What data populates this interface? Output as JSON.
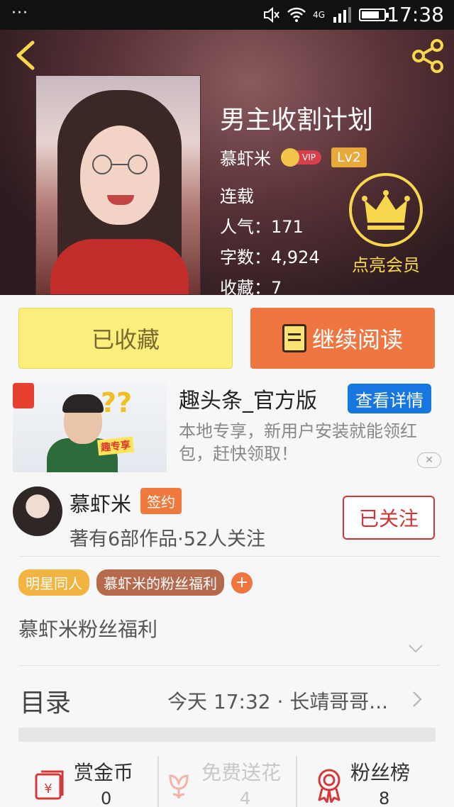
{
  "status_bar": {
    "time": "17:38",
    "network": "4G",
    "battery_level": 0.8,
    "icons": [
      "more-dots-icon",
      "mute-icon",
      "wifi-icon",
      "signal-icon",
      "battery-icon"
    ]
  },
  "header": {
    "title": "男主收割计划",
    "author": "慕虾米",
    "vip_badge": "VIP",
    "level": "Lv2",
    "status": "连载",
    "popularity_label": "人气：",
    "popularity": "171",
    "words_label": "字数：",
    "words": "4,924",
    "favorites_label": "收藏：",
    "favorites": "7",
    "member_label": "点亮会员",
    "accent_color": "#f7d74d"
  },
  "actions": {
    "collected_label": "已收藏",
    "continue_label": "继续阅读"
  },
  "ad": {
    "title": "趣头条_官方版",
    "button_label": "查看详情",
    "description": "本地专享，新用户安装就能领红包，赶快领取！",
    "image_marks": "??",
    "image_banner": "趣专享"
  },
  "author_block": {
    "name": "慕虾米",
    "badge": "签约",
    "meta": "著有6部作品·52人关注",
    "follow_label": "已关注"
  },
  "tags": [
    "明星同人",
    "慕虾米的粉丝福利"
  ],
  "tag_add": "+",
  "description": "慕虾米粉丝福利",
  "catalog": {
    "label": "目录",
    "latest": "今天 17:32 · 长靖哥哥..."
  },
  "bottom_actions": [
    {
      "label": "赏金币",
      "count": "0",
      "icon": "red-envelope-icon",
      "color": "#333"
    },
    {
      "label": "免费送花",
      "count": "4",
      "icon": "flower-icon",
      "color": "#c8c8c8"
    },
    {
      "label": "粉丝榜",
      "count": "8",
      "icon": "medal-icon",
      "color": "#333"
    }
  ]
}
